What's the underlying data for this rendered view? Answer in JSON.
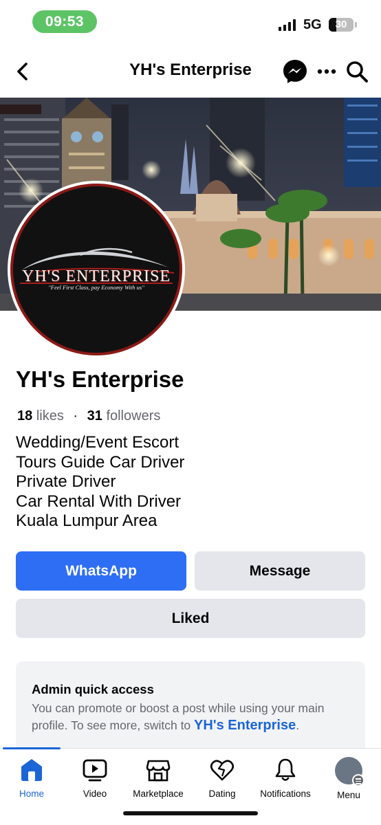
{
  "status_bar": {
    "time": "09:53",
    "network": "5G",
    "battery": "30",
    "battery_level": 0.3
  },
  "header": {
    "title": "YH's Enterprise",
    "icons": [
      "back-icon",
      "messenger-icon",
      "more-icon",
      "search-icon"
    ]
  },
  "profile": {
    "logo_name": "YH'S ENTERPRISE",
    "logo_tagline": "\"Feel First Class, pay Economy With us\"",
    "name": "YH's Enterprise",
    "likes_count": "18",
    "likes_label": "likes",
    "separator": "·",
    "followers_count": "31",
    "followers_label": "followers",
    "bio": [
      "Wedding/Event Escort",
      "Tours Guide Car Driver",
      "Private Driver",
      "Car Rental With Driver",
      "Kuala Lumpur Area"
    ]
  },
  "actions": {
    "whatsapp": "WhatsApp",
    "message": "Message",
    "liked": "Liked"
  },
  "admin": {
    "title": "Admin quick access",
    "description": "You can promote or boost a post while using your main profile. To see more, switch to",
    "link": "YH's Enterprise",
    "suffix": "."
  },
  "bottom_nav": {
    "items": [
      {
        "label": "Home",
        "icon": "home-icon",
        "active": true
      },
      {
        "label": "Video",
        "icon": "video-icon"
      },
      {
        "label": "Marketplace",
        "icon": "marketplace-icon"
      },
      {
        "label": "Dating",
        "icon": "dating-icon"
      },
      {
        "label": "Notifications",
        "icon": "bell-icon"
      },
      {
        "label": "Menu",
        "icon": "menu-avatar"
      }
    ]
  },
  "colors": {
    "primary": "#2d6ef5",
    "link": "#1b66d6",
    "time_pill": "#5dc466",
    "logo_red": "#8b1a17"
  }
}
